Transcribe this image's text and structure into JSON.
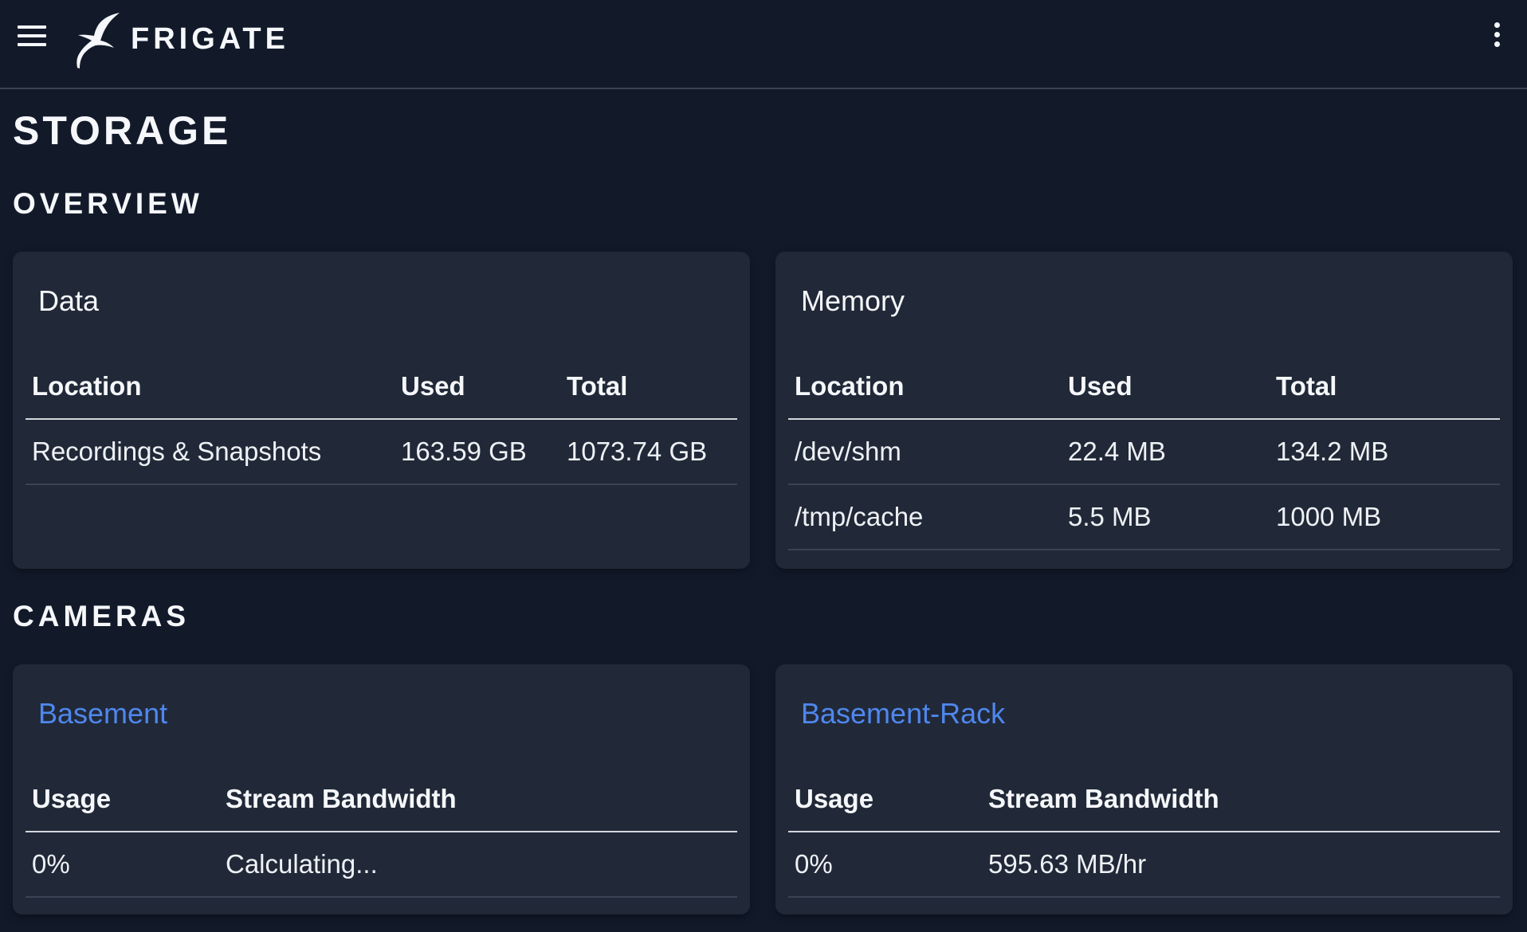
{
  "header": {
    "app_name": "FRIGATE"
  },
  "page": {
    "title": "STORAGE",
    "overview_heading": "OVERVIEW",
    "cameras_heading": "CAMERAS"
  },
  "data_card": {
    "title": "Data",
    "columns": [
      "Location",
      "Used",
      "Total"
    ],
    "rows": [
      [
        "Recordings & Snapshots",
        "163.59 GB",
        "1073.74 GB"
      ]
    ]
  },
  "memory_card": {
    "title": "Memory",
    "columns": [
      "Location",
      "Used",
      "Total"
    ],
    "rows": [
      [
        "/dev/shm",
        "22.4 MB",
        "134.2 MB"
      ],
      [
        "/tmp/cache",
        "5.5 MB",
        "1000 MB"
      ]
    ]
  },
  "cameras": [
    {
      "name": "Basement",
      "columns": [
        "Usage",
        "Stream Bandwidth"
      ],
      "usage": "0%",
      "bandwidth": "Calculating..."
    },
    {
      "name": "Basement-Rack",
      "columns": [
        "Usage",
        "Stream Bandwidth"
      ],
      "usage": "0%",
      "bandwidth": "595.63 MB/hr"
    }
  ],
  "colors": {
    "background": "#121a2a",
    "card": "#212938",
    "link": "#4f87ee",
    "text": "#f5f7fa"
  },
  "icons": {
    "menu": "hamburger-menu-icon",
    "logo": "frigate-bird-icon",
    "more": "vertical-dots-icon"
  }
}
